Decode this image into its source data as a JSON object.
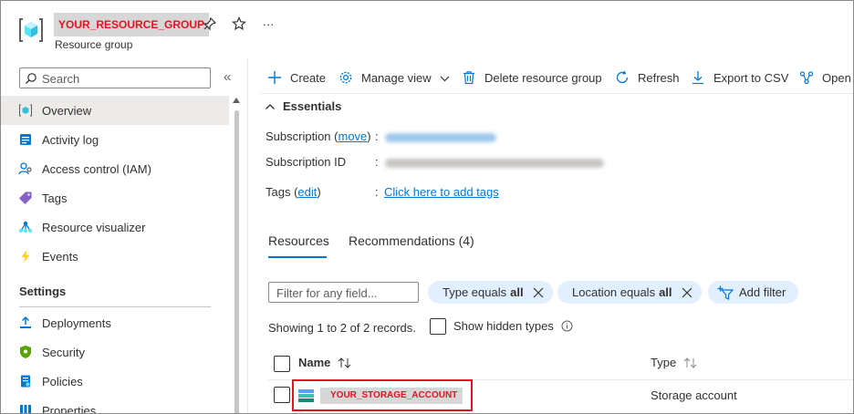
{
  "header": {
    "title": "YOUR_RESOURCE_GROUP",
    "subtitle": "Resource group",
    "more": "···"
  },
  "sidebar": {
    "search_placeholder": "Search",
    "collapse": "«",
    "items": [
      {
        "label": "Overview",
        "icon": "overview-icon"
      },
      {
        "label": "Activity log",
        "icon": "activity-log-icon"
      },
      {
        "label": "Access control (IAM)",
        "icon": "iam-icon"
      },
      {
        "label": "Tags",
        "icon": "tag-icon"
      },
      {
        "label": "Resource visualizer",
        "icon": "visualizer-icon"
      },
      {
        "label": "Events",
        "icon": "lightning-icon"
      }
    ],
    "settings_header": "Settings",
    "settings_items": [
      {
        "label": "Deployments",
        "icon": "deployments-icon"
      },
      {
        "label": "Security",
        "icon": "shield-icon"
      },
      {
        "label": "Policies",
        "icon": "policies-icon"
      },
      {
        "label": "Properties",
        "icon": "properties-icon"
      }
    ]
  },
  "toolbar": {
    "create": "Create",
    "manage_view": "Manage view",
    "delete": "Delete resource group",
    "refresh": "Refresh",
    "export": "Export to CSV",
    "open": "Open"
  },
  "essentials": {
    "title": "Essentials",
    "subscription_label": "Subscription (",
    "subscription_move": "move",
    "subscription_close": ")",
    "subscription_id_label": "Subscription ID",
    "tags_label": "Tags (",
    "tags_edit": "edit",
    "tags_close": ")",
    "colon": ":",
    "tags_link": "Click here to add tags"
  },
  "tabs": {
    "resources": "Resources",
    "recommendations": "Recommendations (4)"
  },
  "filters": {
    "placeholder": "Filter for any field...",
    "type_pill_label": "Type equals",
    "type_pill_value": "all",
    "location_pill_label": "Location equals",
    "location_pill_value": "all",
    "add_filter": "Add filter"
  },
  "records": {
    "showing": "Showing 1 to 2 of 2 records.",
    "show_hidden": "Show hidden types"
  },
  "table": {
    "columns": [
      "Name",
      "Type"
    ],
    "rows": [
      {
        "name": "YOUR_STORAGE_ACCOUNT",
        "type": "Storage account"
      }
    ]
  },
  "colors": {
    "accent": "#0078d4",
    "highlight": "#e81123",
    "pill_bg": "#e1efff"
  }
}
